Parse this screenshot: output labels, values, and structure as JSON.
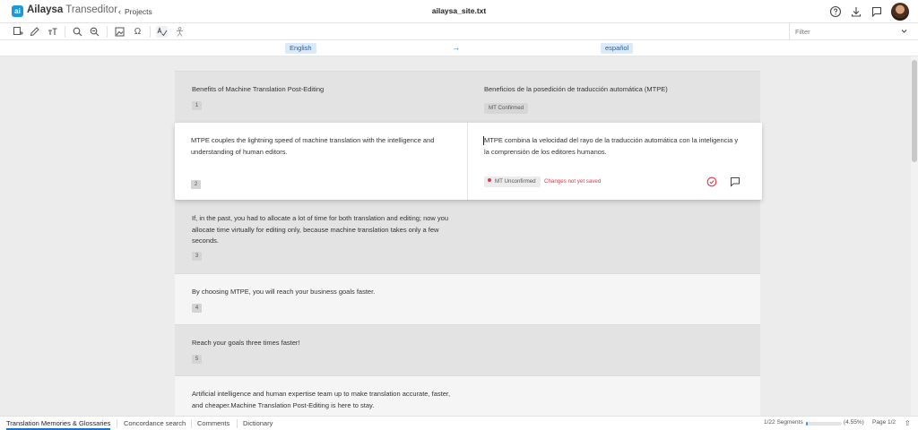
{
  "header": {
    "brand_bold": "Ailaysa",
    "brand_light": "Transeditor",
    "logo_text": "ai",
    "back_label": "Projects",
    "file_name": "ailaysa_site.txt",
    "icons": [
      "help-icon",
      "download-icon",
      "comment-icon",
      "avatar"
    ]
  },
  "toolbar": {
    "icons": [
      "merge-icon",
      "edit-icon",
      "text-size-icon",
      "search-icon",
      "find-replace-icon",
      "image-icon",
      "omega-icon",
      "spellcheck-icon",
      "person-icon"
    ],
    "filter_label": "Filter"
  },
  "languages": {
    "source": "English",
    "target": "español",
    "arrow": "→"
  },
  "segments": [
    {
      "id": "1",
      "source": "Benefits of Machine Translation Post-Editing",
      "target": "Beneficios de la posedición de traducción automática (MTPE)",
      "status": "MT Confirmed"
    },
    {
      "id": "2",
      "source": "MTPE couples the lightning speed of machine translation with the intelligence and understanding of human editors.",
      "target": "MTPE combina la velocidad del rayo de la traducción automática con la inteligencia y la comprensión de los editores humanos.",
      "status": "MT Unconfirmed",
      "note": "Changes not yet saved"
    },
    {
      "id": "3",
      "source": "If, in the past, you had to allocate a lot of time for both translation and editing; now you allocate time virtually for editing only, because machine translation takes only a few seconds."
    },
    {
      "id": "4",
      "source": "By choosing MTPE, you will reach your business goals faster."
    },
    {
      "id": "5",
      "source": "Reach your goals three times faster!"
    },
    {
      "id": "6",
      "source": "Artificial intelligence and human expertise team up to make translation accurate, faster, and cheaper.Machine Translation Post-Editing is here to stay."
    }
  ],
  "bottom": {
    "tabs": [
      "Translation Memories & Glossaries",
      "Concordance search",
      "Comments",
      "Dictionary"
    ],
    "segments_label": "1/22 Segments",
    "progress_fraction": 0.0455,
    "progress_pct": "(4.55%)",
    "page_label": "Page 1/2",
    "arrow": "⇧"
  },
  "colors": {
    "accent": "#1d72c9",
    "brand": "#1a9bd7",
    "warning": "#e0384c"
  }
}
